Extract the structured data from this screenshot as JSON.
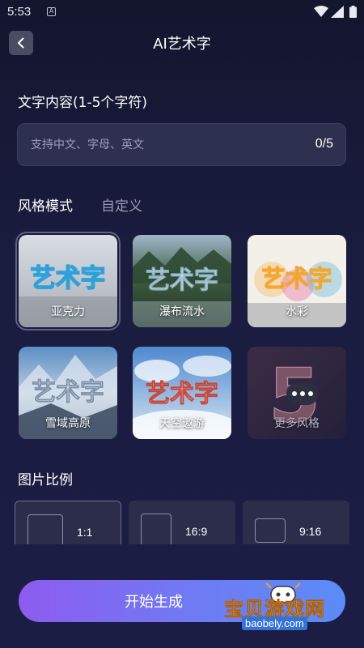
{
  "status_bar": {
    "time": "5:53",
    "app_icon": "A"
  },
  "header": {
    "title": "AI艺术字",
    "back_icon": "chevron-left-icon"
  },
  "text_input": {
    "label": "文字内容(1-5个字符)",
    "placeholder": "支持中文、字母、英文",
    "value": "",
    "count": "0/5"
  },
  "style_tabs": {
    "active": "风格模式",
    "inactive": "自定义"
  },
  "styles": [
    {
      "name": "亚克力",
      "art": "艺术字",
      "selected": true
    },
    {
      "name": "瀑布流水",
      "art": "艺术字"
    },
    {
      "name": "水彩",
      "art": "艺术字"
    },
    {
      "name": "雪域高原",
      "art": "艺术字"
    },
    {
      "name": "天空遨游",
      "art": "艺术字"
    },
    {
      "name": "更多风格",
      "art": "5"
    }
  ],
  "ratio": {
    "label": "图片比例",
    "options": [
      {
        "label": "1:1",
        "selected": true
      },
      {
        "label": "16:9"
      },
      {
        "label": "9:16"
      }
    ]
  },
  "start_button": {
    "label": "开始生成"
  },
  "watermark": {
    "title": "宝贝游戏网",
    "url": "baobely.com"
  },
  "colors": {
    "accent_start": "#8d5cf0",
    "accent_end": "#5a8cf6",
    "background": "#1a1c3f"
  }
}
